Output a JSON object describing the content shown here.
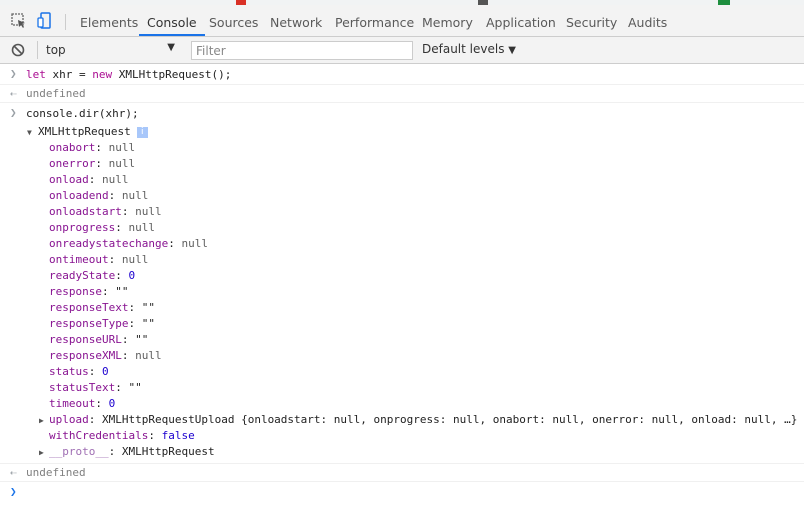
{
  "tabs": [
    "Elements",
    "Console",
    "Sources",
    "Network",
    "Performance",
    "Memory",
    "Application",
    "Security",
    "Audits"
  ],
  "selected_tab": "Console",
  "toolbar": {
    "context": "top",
    "filter_placeholder": "Filter",
    "levels": "Default levels"
  },
  "console": {
    "input1": "let xhr = new XMLHttpRequest();",
    "result1": "undefined",
    "input2": "console.dir(xhr);",
    "object_name": "XMLHttpRequest",
    "info_badge": "i",
    "properties": [
      {
        "key": "onabort",
        "value": "null",
        "kind": "null"
      },
      {
        "key": "onerror",
        "value": "null",
        "kind": "null"
      },
      {
        "key": "onload",
        "value": "null",
        "kind": "null"
      },
      {
        "key": "onloadend",
        "value": "null",
        "kind": "null"
      },
      {
        "key": "onloadstart",
        "value": "null",
        "kind": "null"
      },
      {
        "key": "onprogress",
        "value": "null",
        "kind": "null"
      },
      {
        "key": "onreadystatechange",
        "value": "null",
        "kind": "null"
      },
      {
        "key": "ontimeout",
        "value": "null",
        "kind": "null"
      },
      {
        "key": "readyState",
        "value": "0",
        "kind": "num"
      },
      {
        "key": "response",
        "value": "\"\"",
        "kind": "str"
      },
      {
        "key": "responseText",
        "value": "\"\"",
        "kind": "str"
      },
      {
        "key": "responseType",
        "value": "\"\"",
        "kind": "str"
      },
      {
        "key": "responseURL",
        "value": "\"\"",
        "kind": "str"
      },
      {
        "key": "responseXML",
        "value": "null",
        "kind": "null"
      },
      {
        "key": "status",
        "value": "0",
        "kind": "num"
      },
      {
        "key": "statusText",
        "value": "\"\"",
        "kind": "str"
      },
      {
        "key": "timeout",
        "value": "0",
        "kind": "num"
      },
      {
        "key": "upload",
        "value": "XMLHttpRequestUpload {onloadstart: null, onprogress: null, onabort: null, onerror: null, onload: null, …}",
        "kind": "obj",
        "expandable": true
      },
      {
        "key": "withCredentials",
        "value": "false",
        "kind": "num"
      },
      {
        "key": "__proto__",
        "value": "XMLHttpRequest",
        "kind": "obj",
        "expandable": true
      }
    ],
    "result2": "undefined"
  }
}
